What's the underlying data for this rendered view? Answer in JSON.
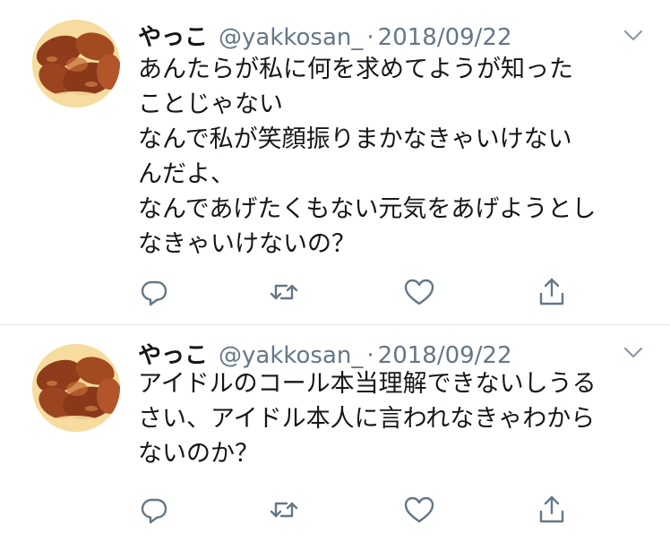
{
  "tweets": [
    {
      "name": "やっこ",
      "handle": "@yakkosan_",
      "separator": "·",
      "date": "2018/09/22",
      "lines": [
        "あんたらが私に何を求めてようが知った",
        "ことじゃない",
        "なんで私が笑顔振りまかなきゃいけない",
        "んだよ、",
        "なんであげたくもない元気をあげようとし",
        "なきゃいけないの？"
      ]
    },
    {
      "name": "やっこ",
      "handle": "@yakkosan_",
      "separator": "·",
      "date": "2018/09/22",
      "lines": [
        "アイドルのコール本当理解できないしうる",
        "さい、アイドル本人に言われなきゃわから",
        "ないのか？"
      ]
    }
  ],
  "icons": {
    "reply": "reply-icon",
    "retweet": "retweet-icon",
    "like": "heart-icon",
    "share": "share-icon",
    "caret": "chevron-down-icon"
  },
  "colors": {
    "text": "#14171a",
    "secondary": "#657786",
    "divider": "#e1e8ed"
  }
}
